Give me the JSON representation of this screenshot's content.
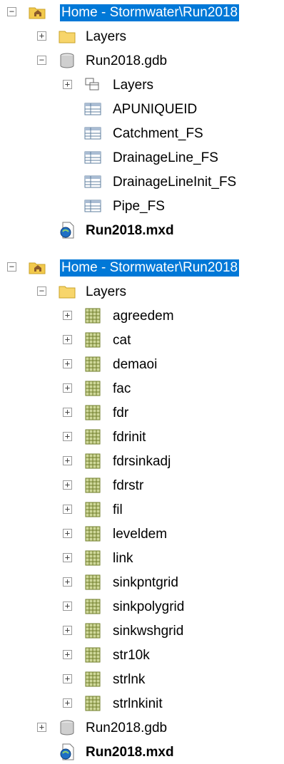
{
  "tree1": {
    "root": {
      "label": "Home - Stormwater\\Run2018",
      "expander": "⊟",
      "icon": "folder-home-icon"
    },
    "layers": {
      "label": "Layers",
      "expander": "⊞",
      "icon": "folder-icon"
    },
    "gdb": {
      "label": "Run2018.gdb",
      "expander": "⊟",
      "icon": "database-icon"
    },
    "gdb_children": [
      {
        "label": "Layers",
        "expander": "⊞",
        "icon": "feature-dataset-icon"
      },
      {
        "label": "APUNIQUEID",
        "icon": "table-icon"
      },
      {
        "label": "Catchment_FS",
        "icon": "table-icon"
      },
      {
        "label": "DrainageLine_FS",
        "icon": "table-icon"
      },
      {
        "label": "DrainageLineInit_FS",
        "icon": "table-icon"
      },
      {
        "label": "Pipe_FS",
        "icon": "table-icon"
      }
    ],
    "mxd": {
      "label": "Run2018.mxd",
      "icon": "map-document-icon"
    }
  },
  "tree2": {
    "root": {
      "label": "Home - Stormwater\\Run2018",
      "expander": "⊟",
      "icon": "folder-home-icon"
    },
    "layers": {
      "label": "Layers",
      "expander": "⊟",
      "icon": "folder-icon"
    },
    "rasters": [
      {
        "label": "agreedem"
      },
      {
        "label": "cat"
      },
      {
        "label": "demaoi"
      },
      {
        "label": "fac"
      },
      {
        "label": "fdr"
      },
      {
        "label": "fdrinit"
      },
      {
        "label": "fdrsinkadj"
      },
      {
        "label": "fdrstr"
      },
      {
        "label": "fil"
      },
      {
        "label": "leveldem"
      },
      {
        "label": "link"
      },
      {
        "label": "sinkpntgrid"
      },
      {
        "label": "sinkpolygrid"
      },
      {
        "label": "sinkwshgrid"
      },
      {
        "label": "str10k"
      },
      {
        "label": "strlnk"
      },
      {
        "label": "strlnkinit"
      }
    ],
    "raster_icon": "raster-grid-icon",
    "gdb": {
      "label": "Run2018.gdb",
      "expander": "⊞",
      "icon": "database-icon"
    },
    "mxd": {
      "label": "Run2018.mxd",
      "icon": "map-document-icon"
    }
  },
  "colors": {
    "selection": "#0078d7",
    "folder": "#f7d56b",
    "raster": "#7b8a3a"
  }
}
